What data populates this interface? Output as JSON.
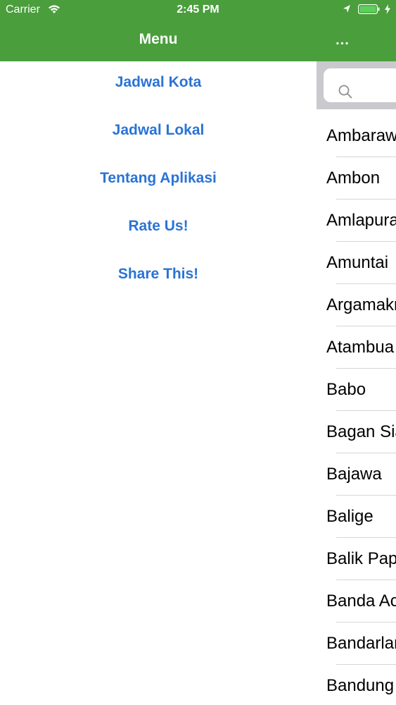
{
  "status_bar": {
    "carrier": "Carrier",
    "time": "2:45 PM"
  },
  "nav": {
    "menu_title": "Menu",
    "more_label": "..."
  },
  "menu": {
    "items": [
      {
        "label": "Jadwal Kota"
      },
      {
        "label": "Jadwal Lokal"
      },
      {
        "label": "Tentang Aplikasi"
      },
      {
        "label": "Rate Us!"
      },
      {
        "label": "Share This!"
      }
    ]
  },
  "cities": [
    "Ambarawa",
    "Ambon",
    "Amlapura",
    "Amuntai",
    "Argamakmur",
    "Atambua",
    "Babo",
    "Bagan Siapiapi",
    "Bajawa",
    "Balige",
    "Balik Papan",
    "Banda Aceh",
    "Bandarlampung",
    "Bandung"
  ],
  "colors": {
    "nav_green": "#4a9e3c",
    "link_blue": "#2a73d6"
  }
}
